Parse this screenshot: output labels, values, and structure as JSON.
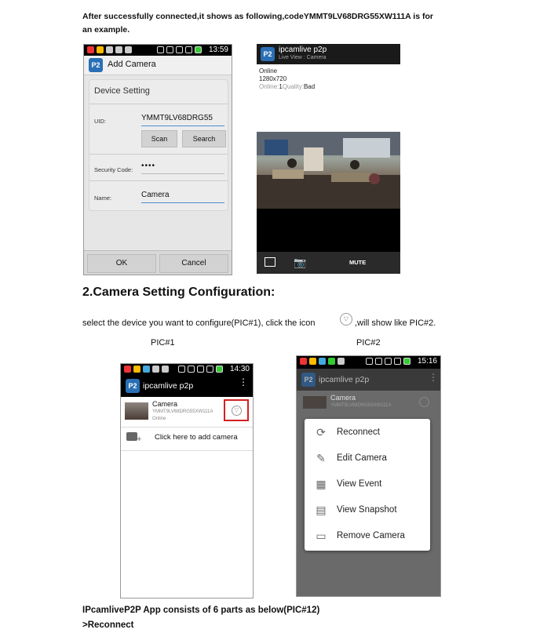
{
  "intro_text": "After successfully connected,it shows as following,codeYMMT9LV68DRG55XW111A is for an example.",
  "add_camera_screen": {
    "status_time": "13:59",
    "title": "Add Camera",
    "section_title": "Device Setting",
    "uid_label": "UID:",
    "uid_value": "YMMT9LV68DRG55",
    "scan_label": "Scan",
    "search_label": "Search",
    "security_code_label": "Security Code:",
    "security_code_value": "••••",
    "name_label": "Name:",
    "name_value": "Camera",
    "ok_label": "OK",
    "cancel_label": "Cancel"
  },
  "live_view_screen": {
    "app_title": "ipcamlive p2p",
    "subtitle": "Live View : Camera",
    "status": "Online",
    "resolution": "1280x720",
    "online_label": "Online:",
    "online_count": "1",
    "quality_label": "Quality:",
    "quality_value": "Bad",
    "mute_label": "MUTE"
  },
  "section_heading": "2.Camera Setting Configuration:",
  "instruction_before_icon": "select the device you want to configure(PIC#1), click the icon",
  "instruction_after_icon": ",will show like PIC#2.",
  "pic1_label": "PIC#1",
  "pic2_label": "PIC#2",
  "camera_list_screen": {
    "status_time": "14:30",
    "app_title": "ipcamlive p2p",
    "camera_name": "Camera",
    "camera_uid": "YMMT9LV68DRG55XW111A",
    "camera_status": "Online",
    "add_camera_text": "Click here to add camera"
  },
  "context_menu_screen": {
    "status_time": "15:16",
    "app_title": "ipcamlive p2p",
    "camera_name": "Camera",
    "camera_uid": "YMMT9LV68DRG55XW111A",
    "menu_items": [
      {
        "label": "Reconnect",
        "icon": "refresh-icon"
      },
      {
        "label": "Edit Camera",
        "icon": "pencil-icon"
      },
      {
        "label": "View Event",
        "icon": "calendar-icon"
      },
      {
        "label": "View Snapshot",
        "icon": "image-icon"
      },
      {
        "label": "Remove Camera",
        "icon": "trash-icon"
      }
    ]
  },
  "footer_line1": "IPcamliveP2P App consists of 6 parts as below(PIC#12)",
  "footer_line2": ">Reconnect",
  "colors": {
    "accent_blue": "#2a6fb5",
    "highlight_red": "#d32020"
  }
}
